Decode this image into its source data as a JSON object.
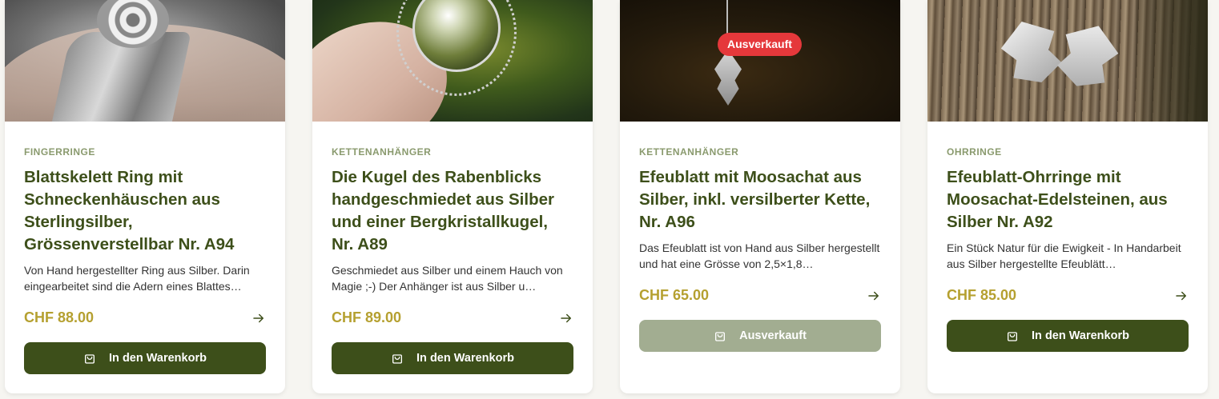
{
  "products": [
    {
      "category": "FINGERRINGE",
      "title": "Blattskelett Ring mit Schneckenhäuschen aus Sterlingsilber, Grössenverstellbar Nr. A94",
      "description": "Von Hand hergestellter Ring aus Silber. Darin eingearbeitet sind die Adern eines Blattes…",
      "price": "CHF 88.00",
      "button_label": "In den Warenkorb",
      "sold_out": false
    },
    {
      "category": "KETTENANHÄNGER",
      "title": "Die Kugel des Rabenblicks handgeschmiedet aus Silber und einer Bergkristallkugel, Nr. A89",
      "description": "Geschmiedet aus Silber und einem Hauch von Magie ;-) Der Anhänger ist aus Silber u…",
      "price": "CHF 89.00",
      "button_label": "In den Warenkorb",
      "sold_out": false
    },
    {
      "category": "KETTENANHÄNGER",
      "title": "Efeublatt mit Moosachat aus Silber, inkl. versilberter Kette, Nr. A96",
      "description": "Das Efeublatt ist von Hand aus Silber hergestellt und hat eine Grösse von 2,5×1,8…",
      "price": "CHF 65.00",
      "button_label": "Ausverkauft",
      "badge": "Ausverkauft",
      "sold_out": true
    },
    {
      "category": "OHRRINGE",
      "title": "Efeublatt-Ohrringe mit Moosachat-Edelsteinen, aus Silber Nr. A92",
      "description": "Ein Stück Natur für die Ewigkeit - In Handarbeit aus Silber hergestellte Efeublätt…",
      "price": "CHF 85.00",
      "button_label": "In den Warenkorb",
      "sold_out": false
    }
  ],
  "colors": {
    "primary": "#3d4f1a",
    "price": "#b5a030",
    "category": "#8a9a6e",
    "sold_out_badge": "#e5383b",
    "disabled_button": "#a2ad91"
  },
  "icons": {
    "cart": "shopping-bag-icon",
    "arrow": "arrow-right-icon"
  }
}
